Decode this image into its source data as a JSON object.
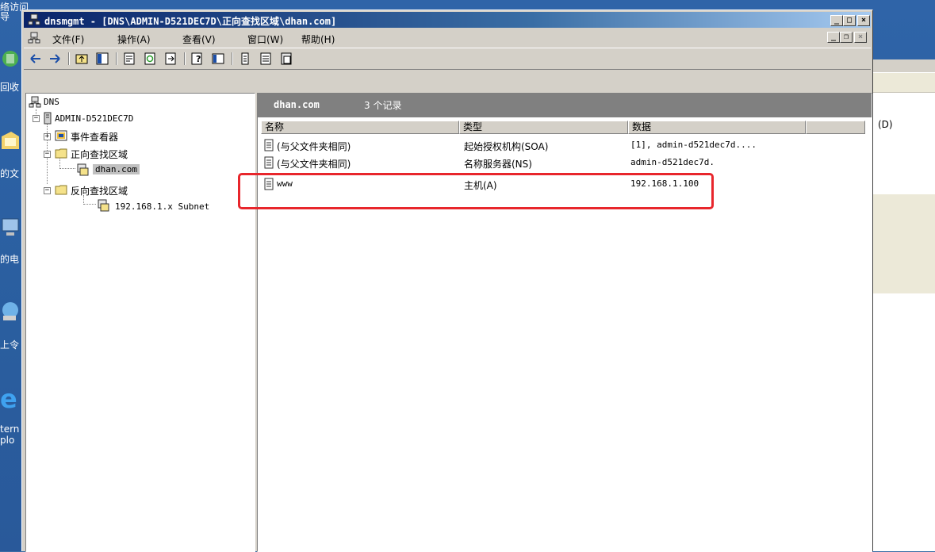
{
  "desktop": {
    "labels": [
      "络访问",
      "导",
      "回收",
      "的文",
      "的电",
      "上令",
      "tern",
      "plo"
    ]
  },
  "window": {
    "title": "dnsmgmt - [DNS\\ADMIN-D521DEC7D\\正向查找区域\\dhan.com]",
    "menu": [
      "文件(F)",
      "操作(A)",
      "查看(V)",
      "窗口(W)",
      "帮助(H)"
    ]
  },
  "toolbar": {
    "icons": [
      "back-arrow-icon",
      "forward-arrow-icon",
      "up-folder-icon",
      "show-hide-tree-icon",
      "properties-icon",
      "refresh-icon",
      "export-list-icon",
      "help-icon",
      "console-icon",
      "new-record-icon",
      "new-record-alt-icon",
      "other-record-icon"
    ]
  },
  "tree": {
    "root": "DNS",
    "server": "ADMIN-D521DEC7D",
    "event_viewer": "事件查看器",
    "forward_zones": "正向查找区域",
    "zone": "dhan.com",
    "reverse_zones": "反向查找区域",
    "subnet": "192.168.1.x Subnet"
  },
  "list": {
    "zone_name": "dhan.com",
    "record_count": "3 个记录",
    "columns": [
      "名称",
      "类型",
      "数据"
    ],
    "rows": [
      {
        "name": "(与父文件夹相同)",
        "type": "起始授权机构(SOA)",
        "data": "[1], admin-d521dec7d...."
      },
      {
        "name": "(与父文件夹相同)",
        "type": "名称服务器(NS)",
        "data": "admin-d521dec7d."
      },
      {
        "name": "www",
        "type": "主机(A)",
        "data": "192.168.1.100"
      }
    ]
  },
  "background_window": {
    "fragment": "(D)"
  },
  "colors": {
    "highlight": "#e8262c",
    "title_start": "#0a246a",
    "pane_header": "#808080"
  }
}
